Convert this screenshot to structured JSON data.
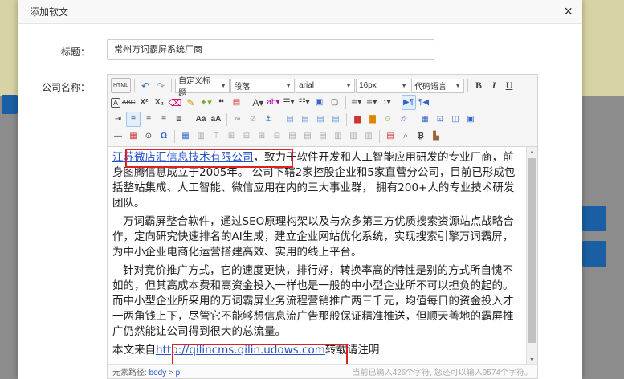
{
  "dialog": {
    "title": "添加软文",
    "close_glyph": "×"
  },
  "form": {
    "title_label": "标题：",
    "title_value": "常州万词霸屏系统厂商",
    "company_label": "公司名称："
  },
  "toolbar": {
    "html_label": "HTML",
    "custom_title": "自定义标题",
    "paragraph": "段落",
    "font_family": "arial",
    "font_size": "16px",
    "code_language": "代码语言",
    "bold": "B",
    "italic": "I",
    "underline": "U"
  },
  "content": {
    "p1_link": "江苏微店汇信息技术有限公司",
    "p1_rest": "，致力于软件开发和人工智能应用研发的专业厂商，前身图腾信息成立于2005年。 公司下辖2家控股企业和5家直营分公司，目前已形成包括整站集成、人工智能、微信应用在内的三大事业群， 拥有200+人的专业技术研发团队。",
    "p2": "万词霸屏整合软件，通过SEO原理构架以及与众多第三方优质搜索资源站点战略合作，定向研究快速排名的AI生成，建立企业网站优化系统，实现搜索引擎万词霸屏，为中小企业电商化运营搭建高效、实用的线上平台。",
    "p3": "针对竞价推广方式，它的速度更快，排行好，转换率高的特性是别的方式所自愧不如的，但其高成本费和高资金投入一样也是一般的中小型企业所不可以担负的起的。而中小型企业所采用的万词霸屏业务流程营销推广两三千元，均值每日的资金投入才一两角钱上下，尽管它不能够想信息流广告那般保证精准推送，但顺天善地的霸屏推广仍然能让公司得到很大的总流量。",
    "p4_prefix": "本文来自",
    "p4_link": "http://qilincms.qilin.udows.com",
    "p4_suffix": "转载请注明"
  },
  "status": {
    "path_label": "元素路径:",
    "path_body": "body",
    "path_sep": ">",
    "path_p": "p",
    "count_text": "当前已输入426个字符, 您还可以输入9574个字符。"
  },
  "icons": [
    "undo-icon",
    "redo-icon",
    "close-icon",
    "bold-icon",
    "italic-icon",
    "underline-icon",
    "emoji-icon",
    "image-icon",
    "search-icon"
  ]
}
